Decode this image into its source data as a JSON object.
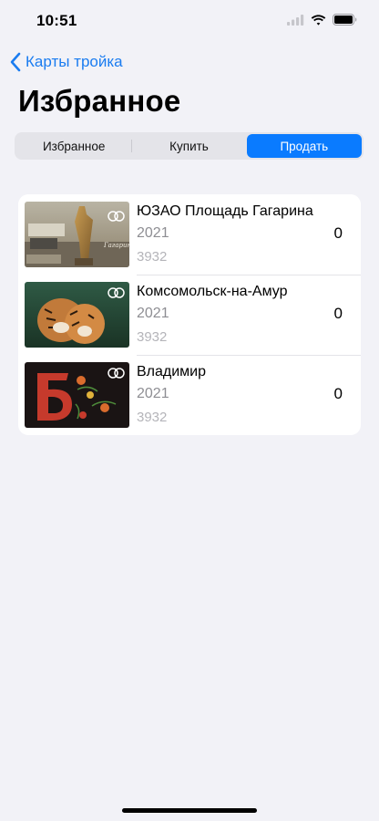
{
  "status": {
    "time": "10:51"
  },
  "nav": {
    "back_label": "Карты тройка"
  },
  "page": {
    "title": "Избранное"
  },
  "segments": [
    {
      "label": "Избранное",
      "active": false
    },
    {
      "label": "Купить",
      "active": false
    },
    {
      "label": "Продать",
      "active": true
    }
  ],
  "cards": [
    {
      "name": "ЮЗАО Площадь Гагарина",
      "year": "2021",
      "code": "3932",
      "count": "0",
      "image": "gagarin-monument-card"
    },
    {
      "name": "Комсомольск-на-Амур",
      "year": "2021",
      "code": "3932",
      "count": "0",
      "image": "tigers-card"
    },
    {
      "name": "Владимир",
      "year": "2021",
      "code": "3932",
      "count": "0",
      "image": "vladimir-ornament-card"
    }
  ],
  "colors": {
    "accent": "#0a7bff",
    "background": "#f2f2f7",
    "link": "#1a7cf0"
  }
}
